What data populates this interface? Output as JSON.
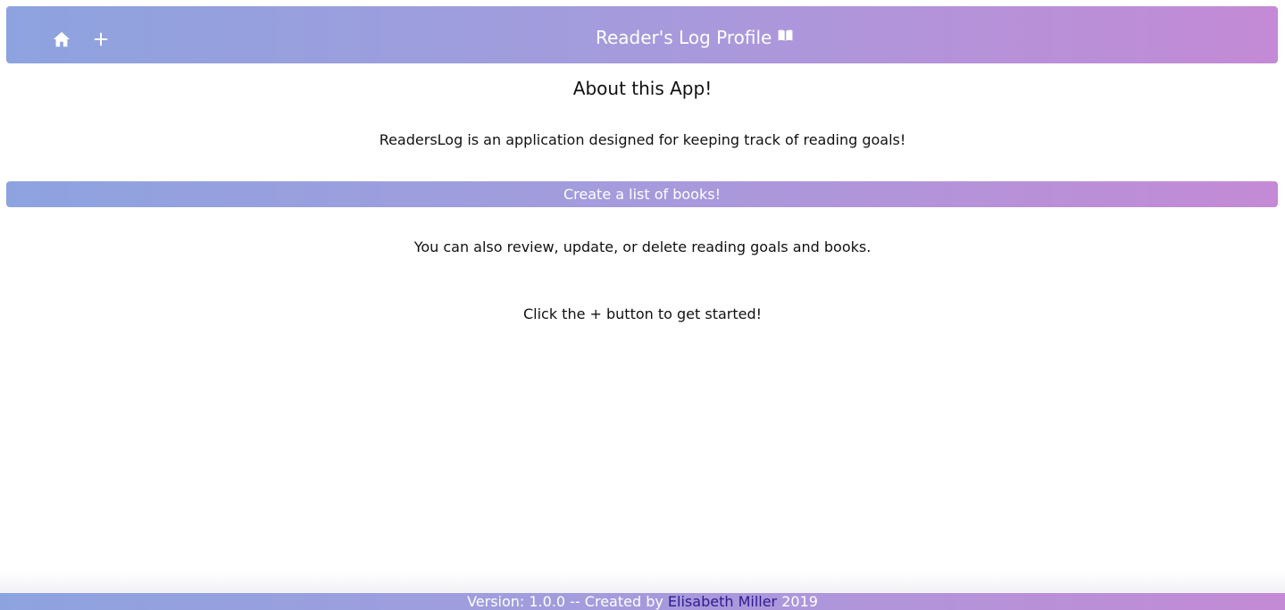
{
  "navbar": {
    "home_icon": "home-icon",
    "add_icon": "plus-icon",
    "title": "Reader's Log Profile",
    "title_icon": "book-open-icon",
    "gradient_start": "#8da3df",
    "gradient_end": "#c48ad6"
  },
  "main": {
    "heading": "About this App!",
    "intro": "ReadersLog is an application designed for keeping track of reading goals!",
    "banner": "Create a list of books!",
    "review_text": "You can also review, update, or delete reading goals and books.",
    "cta_text": "Click the + button to get started!"
  },
  "footer": {
    "prefix": "Version: 1.0.0 -- Created by ",
    "author": "Elisabeth Miller",
    "suffix": " 2019",
    "link_color": "#2f1a8f"
  }
}
